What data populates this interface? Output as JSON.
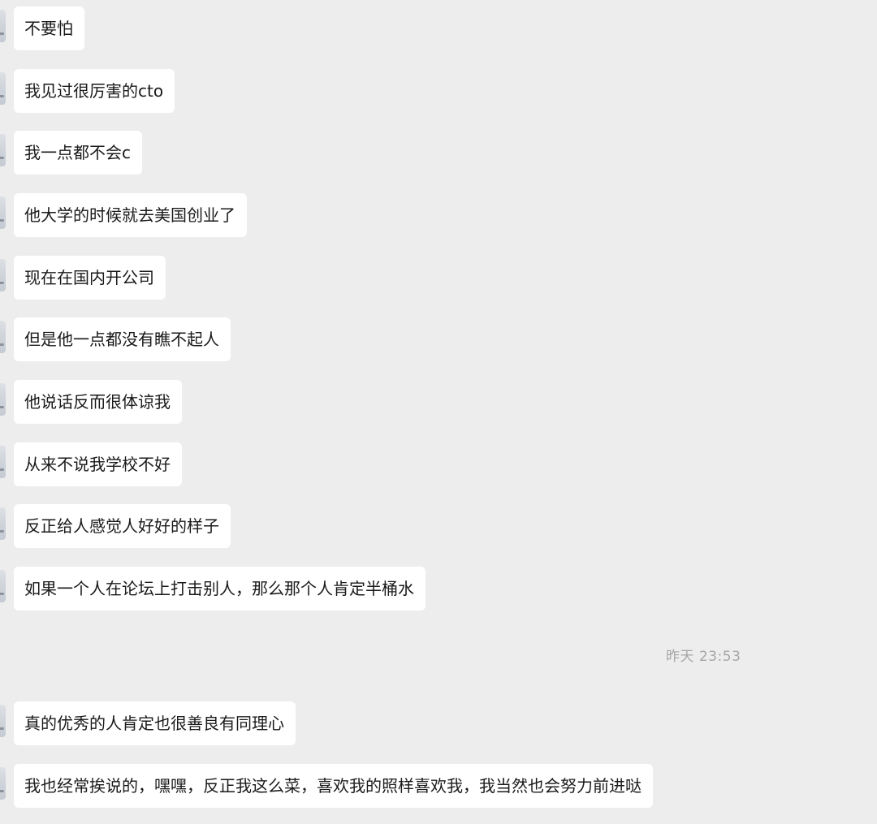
{
  "messages_before": [
    "不要怕",
    "我见过很厉害的cto",
    "我一点都不会c",
    "他大学的时候就去美国创业了",
    "现在在国内开公司",
    "但是他一点都没有瞧不起人",
    "他说话反而很体谅我",
    "从来不说我学校不好",
    "反正给人感觉人好好的样子",
    "如果一个人在论坛上打击别人，那么那个人肯定半桶水"
  ],
  "timestamp": "昨天 23:53",
  "messages_after": [
    "真的优秀的人肯定也很善良有同理心",
    "我也经常挨说的，嘿嘿，反正我这么菜，喜欢我的照样喜欢我，我当然也会努力前进哒"
  ]
}
